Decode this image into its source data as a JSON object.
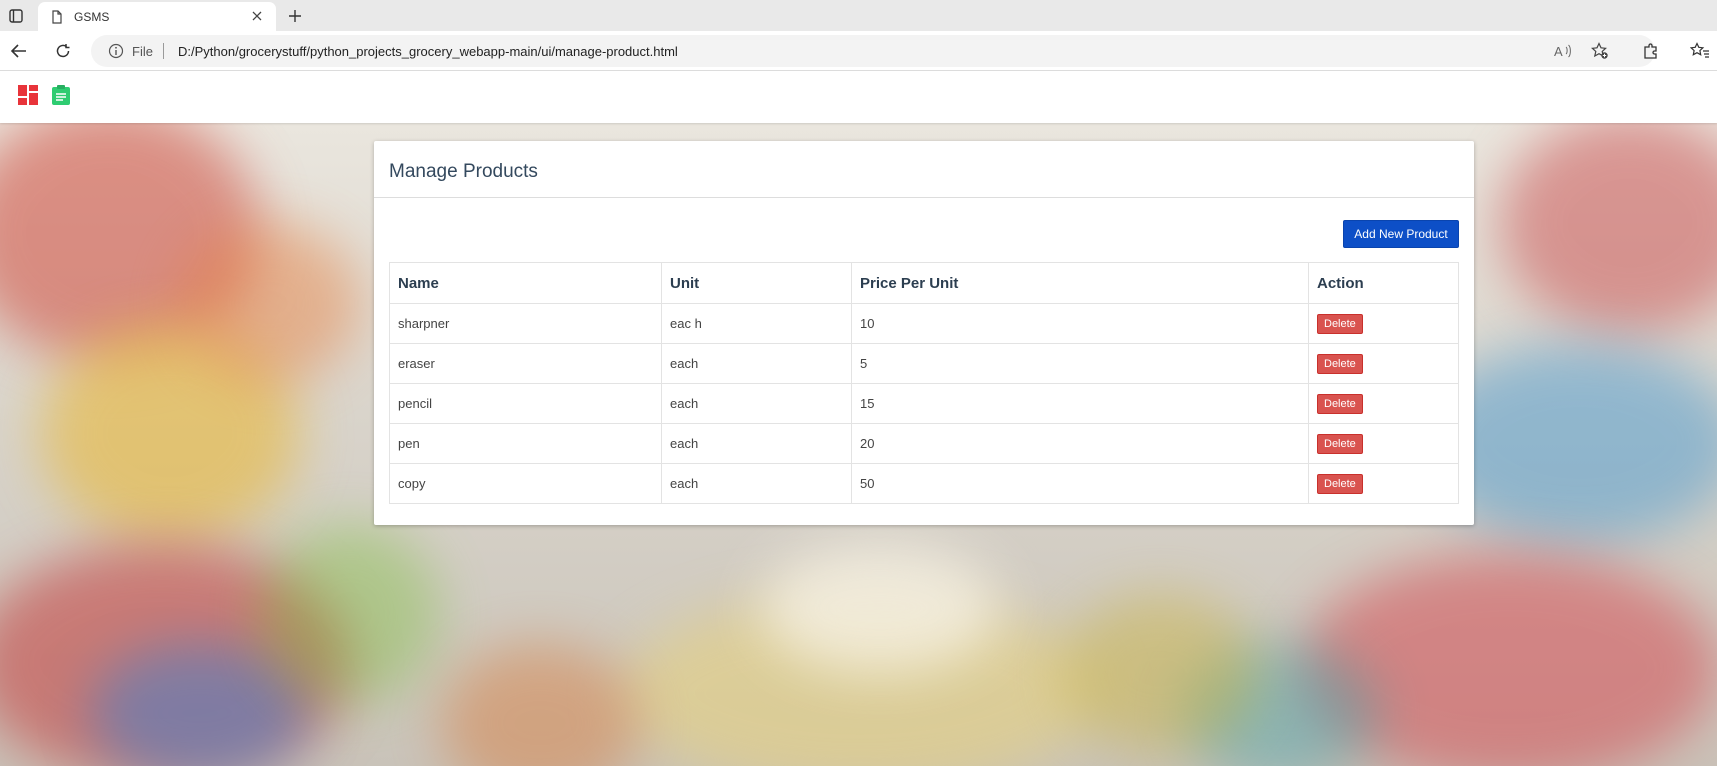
{
  "browser": {
    "tab_title": "GSMS",
    "url_scheme_label": "File",
    "url": "D:/Python/grocerystuff/python_projects_grocery_webapp-main/ui/manage-product.html"
  },
  "navbar": {
    "icons": [
      "dashboard-icon",
      "clipboard-icon"
    ],
    "colors": {
      "dashboard": "#e8343a",
      "clipboard": "#2ecc71"
    }
  },
  "panel": {
    "title": "Manage Products",
    "add_button_label": "Add New Product"
  },
  "table": {
    "columns": [
      "Name",
      "Unit",
      "Price Per Unit",
      "Action"
    ],
    "rows": [
      {
        "name": "sharpner",
        "unit": "eac h",
        "price": "10",
        "action": "Delete"
      },
      {
        "name": "eraser",
        "unit": "each",
        "price": "5",
        "action": "Delete"
      },
      {
        "name": "pencil",
        "unit": "each",
        "price": "15",
        "action": "Delete"
      },
      {
        "name": "pen",
        "unit": "each",
        "price": "20",
        "action": "Delete"
      },
      {
        "name": "copy",
        "unit": "each",
        "price": "50",
        "action": "Delete"
      }
    ]
  },
  "colors": {
    "add_button": "#0d4fc7",
    "delete_button": "#d9534f"
  }
}
